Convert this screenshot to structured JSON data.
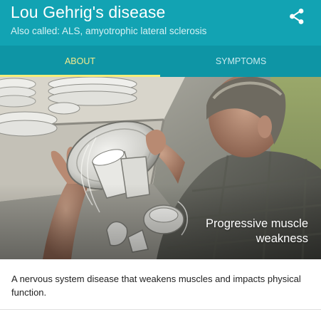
{
  "header": {
    "title": "Lou Gehrig's disease",
    "subtitle": "Also called: ALS, amyotrophic lateral sclerosis",
    "share_icon": "share-icon",
    "background_color": "#12a3b3"
  },
  "tabs": [
    {
      "label": "About",
      "selected": true
    },
    {
      "label": "Symptoms",
      "selected": false
    }
  ],
  "tab_accent_color": "#f4ed7a",
  "hero": {
    "caption": "Progressive muscle weakness",
    "illustration": "man dropping dishes"
  },
  "description": "A nervous system disease that weakens muscles and impacts physical function."
}
